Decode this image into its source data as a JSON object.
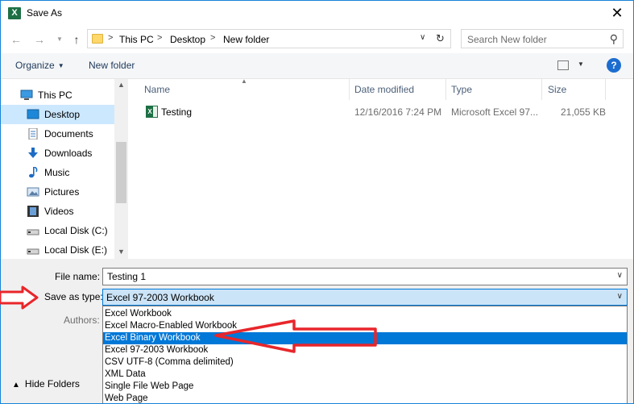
{
  "window": {
    "title": "Save As",
    "app_icon": "excel-icon",
    "close_glyph": "✕"
  },
  "address": {
    "crumbs": [
      "This PC",
      "Desktop",
      "New folder"
    ],
    "separator": ">",
    "search_placeholder": "Search New folder"
  },
  "toolbar": {
    "organize_label": "Organize",
    "new_folder_label": "New folder",
    "help_label": "?"
  },
  "nav": {
    "items": [
      {
        "label": "This PC",
        "icon": "computer-icon"
      },
      {
        "label": "Desktop",
        "icon": "desktop-icon",
        "selected": true
      },
      {
        "label": "Documents",
        "icon": "documents-icon"
      },
      {
        "label": "Downloads",
        "icon": "downloads-icon"
      },
      {
        "label": "Music",
        "icon": "music-icon"
      },
      {
        "label": "Pictures",
        "icon": "pictures-icon"
      },
      {
        "label": "Videos",
        "icon": "videos-icon"
      },
      {
        "label": "Local Disk (C:)",
        "icon": "drive-icon"
      },
      {
        "label": "Local Disk (E:)",
        "icon": "drive-icon"
      }
    ]
  },
  "files": {
    "columns": [
      "Name",
      "Date modified",
      "Type",
      "Size"
    ],
    "rows": [
      {
        "name": "Testing",
        "date": "12/16/2016 7:24 PM",
        "type": "Microsoft Excel 97...",
        "size": "21,055 KB"
      }
    ]
  },
  "form": {
    "file_name_label": "File name:",
    "file_name_value": "Testing 1",
    "save_type_label": "Save as type:",
    "save_type_value": "Excel 97-2003 Workbook",
    "authors_label": "Authors:",
    "hide_folders_label": "Hide Folders"
  },
  "save_type_options": [
    "Excel Workbook",
    "Excel Macro-Enabled Workbook",
    "Excel Binary Workbook",
    "Excel 97-2003 Workbook",
    "CSV UTF-8 (Comma delimited)",
    "XML Data",
    "Single File Web Page",
    "Web Page"
  ],
  "selected_option_index": 2,
  "colors": {
    "accent": "#0078d7",
    "selection": "#cce8ff",
    "annotation": "#e8262b"
  }
}
